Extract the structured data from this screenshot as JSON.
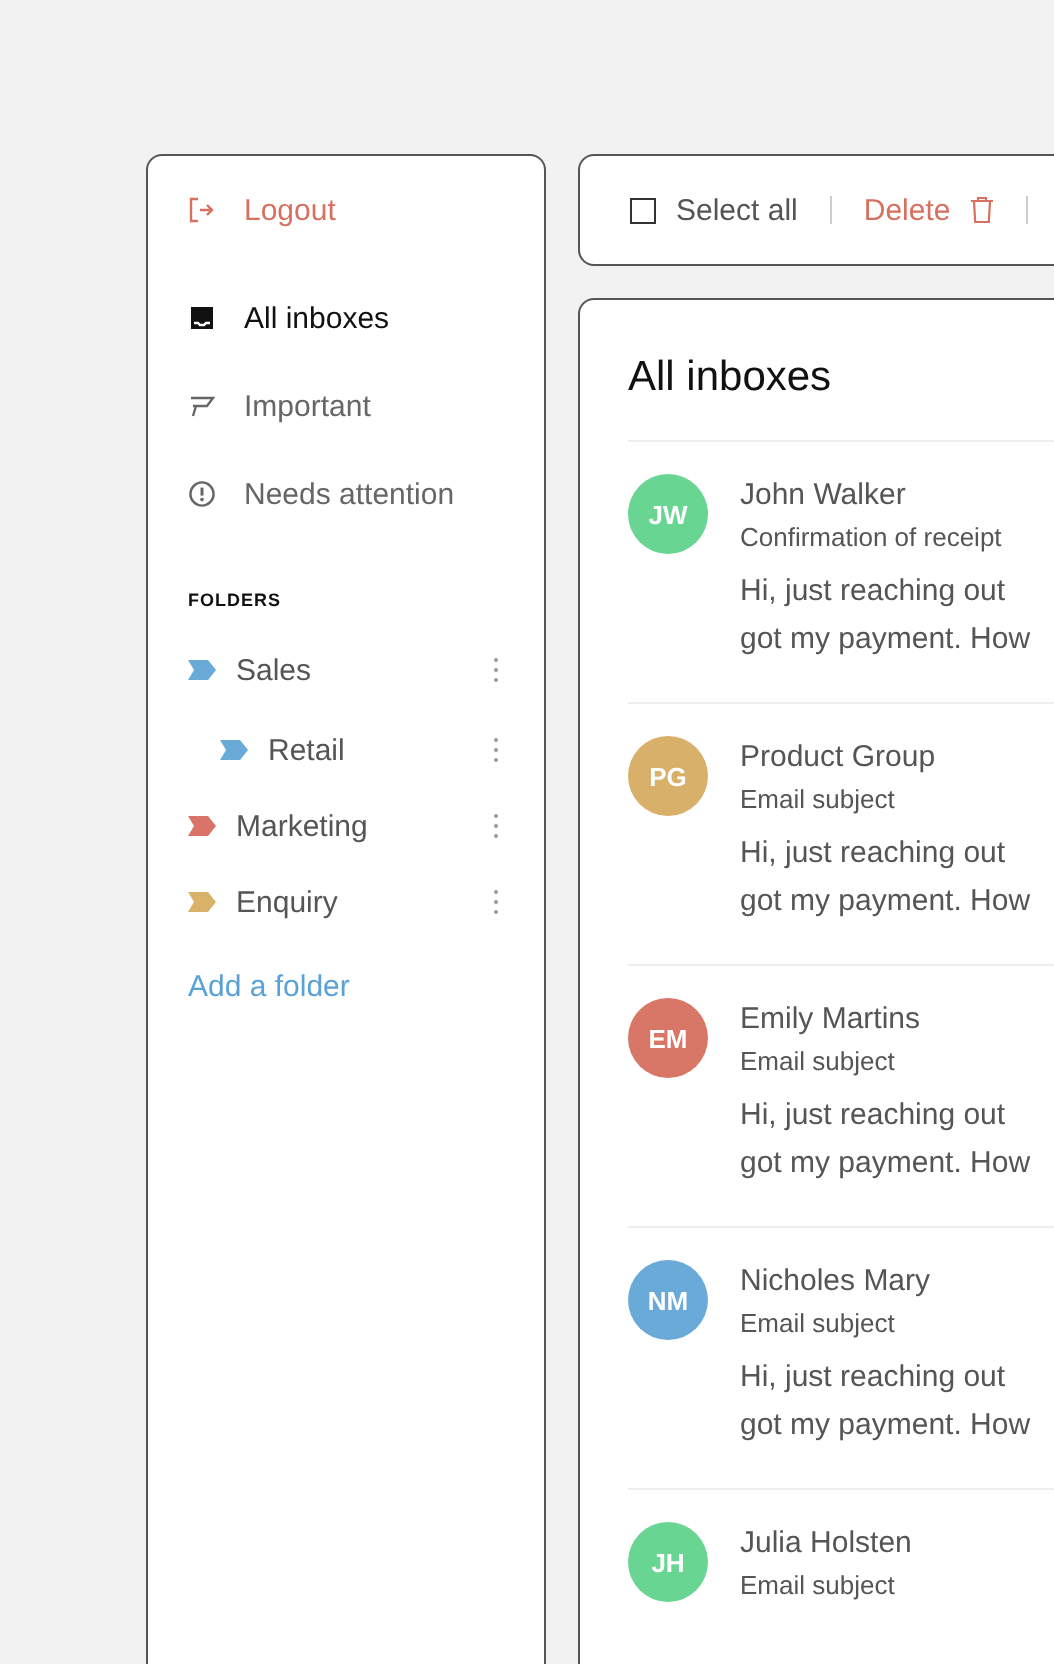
{
  "sidebar": {
    "logout": {
      "label": "Logout"
    },
    "nav": [
      {
        "kind": "inbox",
        "label": "All inboxes",
        "selected": true
      },
      {
        "kind": "flag",
        "label": "Important",
        "selected": false
      },
      {
        "kind": "alert",
        "label": "Needs attention",
        "selected": false
      }
    ],
    "folders_heading": "FOLDERS",
    "folders": [
      {
        "label": "Sales",
        "color": "#6aaad8",
        "children": [
          {
            "label": "Retail",
            "color": "#6aaad8"
          }
        ]
      },
      {
        "label": "Marketing",
        "color": "#db7468"
      },
      {
        "label": "Enquiry",
        "color": "#d9b26a"
      }
    ],
    "add_folder": "Add a folder"
  },
  "toolbar": {
    "select_all": {
      "label": "Select all",
      "checked": false
    },
    "delete": "Delete"
  },
  "inbox": {
    "title": "All inboxes",
    "emails": [
      {
        "initials": "JW",
        "color": "#69d593",
        "sender": "John Walker",
        "subject": "Confirmation of receipt",
        "preview": [
          "Hi, just reaching out",
          "got my payment. How"
        ]
      },
      {
        "initials": "PG",
        "color": "#d8b069",
        "sender": "Product Group",
        "subject": "Email subject",
        "preview": [
          "Hi, just reaching out",
          "got my payment. How"
        ]
      },
      {
        "initials": "EM",
        "color": "#d87767",
        "sender": "Emily Martins",
        "subject": "Email subject",
        "preview": [
          "Hi, just reaching out",
          "got my payment. How"
        ]
      },
      {
        "initials": "NM",
        "color": "#6aaad8",
        "sender": "Nicholes Mary",
        "subject": "Email subject",
        "preview": [
          "Hi, just reaching out",
          "got my payment. How"
        ]
      },
      {
        "initials": "JH",
        "color": "#69d593",
        "sender": "Julia Holsten",
        "subject": "Email subject"
      }
    ]
  }
}
